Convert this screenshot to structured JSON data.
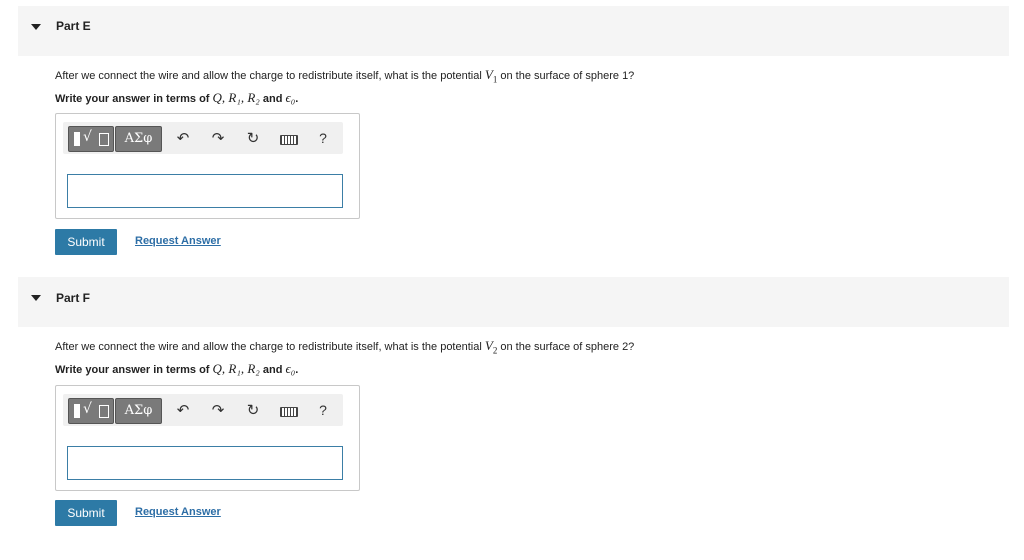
{
  "parts": [
    {
      "title": "Part E",
      "question_prefix": "After we connect the wire and allow the charge to redistribute itself, what is the potential",
      "question_var": "V",
      "question_sub": "1",
      "question_suffix": "on the surface of sphere 1?",
      "instruction_prefix": "Write your answer in terms of",
      "instruction_vars": "Q, R₁, R₂",
      "instruction_and": "and",
      "instruction_last": "ϵ₀",
      "toolbar": {
        "greek": "ΑΣφ",
        "undo": "↶",
        "redo": "↷",
        "reset": "↻",
        "help": "?"
      },
      "answer_value": "",
      "submit_label": "Submit",
      "request_label": "Request Answer"
    },
    {
      "title": "Part F",
      "question_prefix": "After we connect the wire and allow the charge to redistribute itself, what is the potential",
      "question_var": "V",
      "question_sub": "2",
      "question_suffix": "on the surface of sphere 2?",
      "instruction_prefix": "Write your answer in terms of",
      "instruction_vars": "Q, R₁, R₂",
      "instruction_and": "and",
      "instruction_last": "ϵ₀",
      "toolbar": {
        "greek": "ΑΣφ",
        "undo": "↶",
        "redo": "↷",
        "reset": "↻",
        "help": "?"
      },
      "answer_value": "",
      "submit_label": "Submit",
      "request_label": "Request Answer"
    }
  ],
  "colors": {
    "accent": "#2d7aa6",
    "link": "#2d6ea6",
    "header_bg": "#f5f5f5"
  },
  "icons": [
    "caret-down-icon",
    "template-icon",
    "greek-icon",
    "undo-icon",
    "redo-icon",
    "reset-icon",
    "keyboard-icon",
    "help-icon"
  ]
}
